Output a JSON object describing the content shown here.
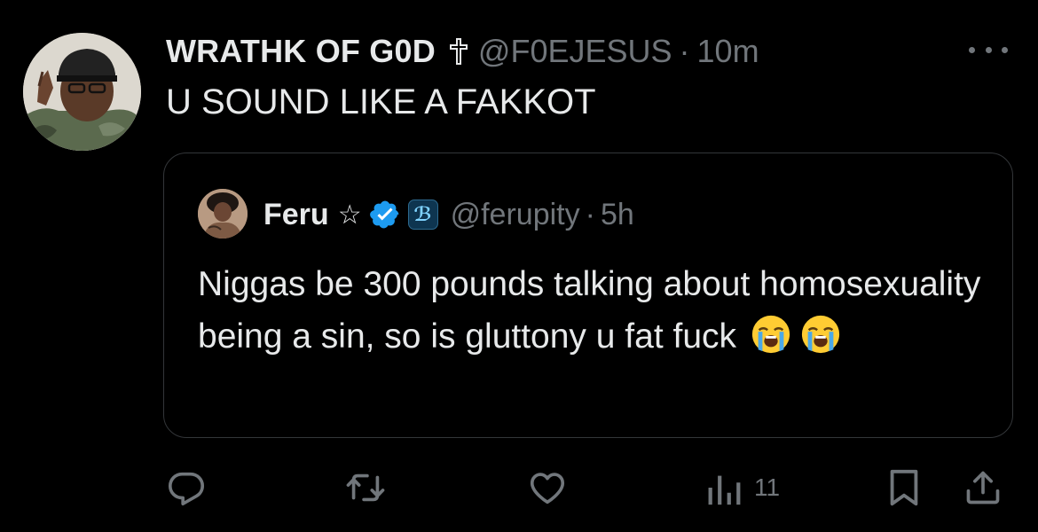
{
  "tweet": {
    "display_name": "WRATHK OF G0D",
    "name_icon": "latin-cross-icon",
    "handle": "@F0EJESUS",
    "separator": "·",
    "time": "10m",
    "text": "U SOUND LIKE A FAKKOT"
  },
  "quote": {
    "display_name": "Feru",
    "star_glyph": "☆",
    "verified_color": "#1d9bf0",
    "handle": "@ferupity",
    "separator": "·",
    "time": "5h",
    "text": "Niggas be 300 pounds talking about homosexuality being a sin, so is gluttony u fat fuck",
    "emojis": [
      "loudly-crying-face",
      "loudly-crying-face"
    ]
  },
  "actions": {
    "views_count": "11",
    "icons": [
      "reply-icon",
      "retweet-icon",
      "like-icon",
      "views-icon",
      "bookmark-icon",
      "share-icon"
    ]
  },
  "colors": {
    "background": "#000000",
    "primary_text": "#e7e9ea",
    "secondary_text": "#71767b",
    "border": "#333639"
  }
}
